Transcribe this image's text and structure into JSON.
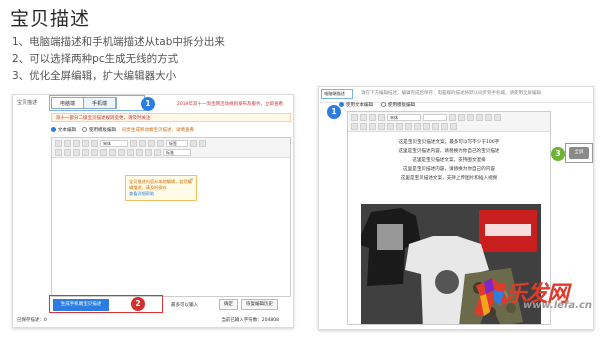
{
  "slide": {
    "title": "宝贝描述",
    "bullets": [
      "1、电脑端描述和手机端描述从tab中拆分出来",
      "2、可以选择两种pc生成无线的方式",
      "3、优化全屏编辑，扩大编辑器大小"
    ]
  },
  "left": {
    "label": "宝贝描述",
    "tabs": [
      "电脑端",
      "手机端"
    ],
    "top_link": "2019年双十一淘宝网活动规则发布及服务，立即查看",
    "banner": "双十一部分二级宝贝描述规则变更，请及时关注",
    "radios": [
      {
        "label": "文本编辑",
        "on": true
      },
      {
        "label": "使用模板编辑",
        "on": false
      }
    ],
    "radio_hint": "同步生成移动端宝贝描述，详情查看",
    "font_select": "宋体",
    "size_select": "标签",
    "style_select": "标准",
    "tip_text": "宝贝描述内容从本地编辑，若您编辑描述，请及时保存",
    "tip_link": "查看详细帮助",
    "mobile_button": "生成手机端宝贝描述",
    "char_count": "最多可以输入",
    "btn_preview": "确定",
    "btn_restore": "恢复编辑历史",
    "footer_left": "已保存描述：0",
    "footer_right": "当前已输入字符数：204808",
    "badge1": "1",
    "badge2": "2"
  },
  "right": {
    "tab_label": "电脑端描述",
    "header_text": "请在下方编辑描述，编辑完成后保存，电脑端的描述将默认同步到手机端。请使用全屏编辑",
    "radios": [
      {
        "label": "使用文本编辑",
        "on": true
      },
      {
        "label": "使用模板编辑",
        "on": false
      }
    ],
    "font_select": "宋体",
    "lines": [
      "这是宝贝宝贝描述文案，最多可以写不少于100字",
      "这里是宝贝描述内容，请替换为你自己的宝贝描述",
      "这里是宝贝描述文案，支持图文混排",
      "这里是宝贝描述内容，请替换为你自己的内容",
      "这里是宝贝描述文案，支持上传图片和插入视频"
    ],
    "side_button": "全屏",
    "badge1": "1",
    "badge3": "3"
  },
  "watermark": {
    "brand": "乐发网",
    "url": "www.lefa.cn"
  },
  "colors": {
    "accent_blue": "#2b7de1",
    "accent_red": "#d32f2f",
    "accent_green": "#6cb233"
  }
}
